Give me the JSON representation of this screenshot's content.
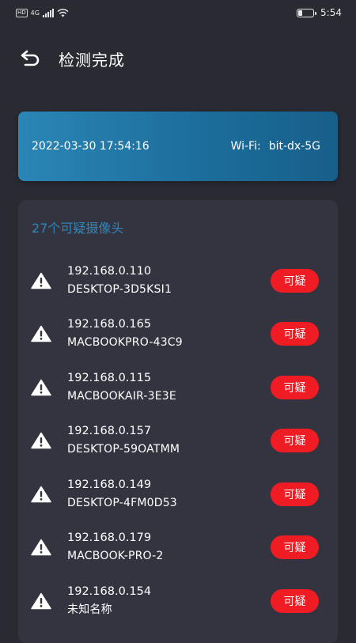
{
  "status_bar": {
    "hd": "HD",
    "network": "4G",
    "time": "5:54"
  },
  "header": {
    "title": "检测完成"
  },
  "info": {
    "datetime": "2022-03-30 17:54:16",
    "wifi_label": "Wi-Fi:",
    "wifi_name": "bit-dx-5G"
  },
  "list": {
    "count_label": "27个可疑摄像头",
    "items": [
      {
        "ip": "192.168.0.110",
        "name": "DESKTOP-3D5KSI1",
        "badge": "可疑"
      },
      {
        "ip": "192.168.0.165",
        "name": "MACBOOKPRO-43C9",
        "badge": "可疑"
      },
      {
        "ip": "192.168.0.115",
        "name": "MACBOOKAIR-3E3E",
        "badge": "可疑"
      },
      {
        "ip": "192.168.0.157",
        "name": "DESKTOP-59OATMM",
        "badge": "可疑"
      },
      {
        "ip": "192.168.0.149",
        "name": "DESKTOP-4FM0D53",
        "badge": "可疑"
      },
      {
        "ip": "192.168.0.179",
        "name": "MACBOOK-PRO-2",
        "badge": "可疑"
      },
      {
        "ip": "192.168.0.154",
        "name": "未知名称",
        "badge": "可疑"
      }
    ]
  },
  "colors": {
    "background": "#2a2a33",
    "card": "#343440",
    "accent": "#2f87b8",
    "badge": "#ef1c24"
  }
}
